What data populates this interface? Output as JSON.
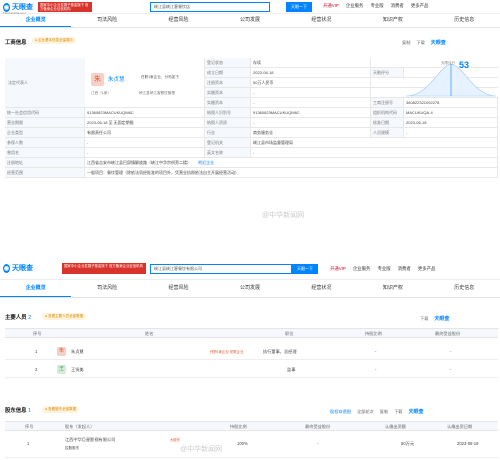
{
  "colors": {
    "brand": "#0084ff",
    "vip_red": "#d9342b",
    "label_bg": "#f5f8fc"
  },
  "header": {
    "logo_text": "天眼查",
    "logo_sub": "TianYanCha.com",
    "red_badge_1": "国家中小企业发展子基金旗下 官方备案企业征信机构",
    "red_badge_2": "国家中小企业发展子基金旗下 官方备案企业征信机构",
    "search_value_1": "峡江县峡江客餐饮店",
    "search_value_2": "峡江县峡江客餐饮有限公司",
    "search_button": "天眼一下",
    "links": [
      "企业服务",
      "应用中心",
      "专业版",
      "消费者",
      "更多产品",
      "消息",
      "APP"
    ],
    "vip_link": "开通VIP"
  },
  "tabs_1": [
    "企业概览",
    "司法风险",
    "经营风险",
    "公司发展",
    "经营状况",
    "知识产权",
    "历史信息"
  ],
  "tabs_2": [
    "企业概览",
    "司法风险",
    "经营风险",
    "公司发展",
    "经营状况",
    "知识产权",
    "历史信息"
  ],
  "business_info": {
    "title": "工商信息",
    "chip": "● 企业基本信息全量展示",
    "toolbar": [
      "复制",
      "下载",
      "天眼查"
    ],
    "legal_rep_label": "法定代表人",
    "legal_rep_avatar": "朱",
    "legal_rep_name": "朱贞慧",
    "legal_rep_role": "任职1家企业，分布如下",
    "legal_rep_loc": "江西（1家）",
    "legal_rep_desc": "峡江县峡江客餐饮管理",
    "rows": [
      {
        "l1": "登记状态",
        "v1": "存续",
        "l2": "",
        "v2": ""
      },
      {
        "l1": "成立日期",
        "v1": "2023-06-18",
        "l2": "天眼评分",
        "v2": ""
      },
      {
        "l1": "注册资本",
        "v1": "50万人民币",
        "l2": "",
        "v2": ""
      },
      {
        "l1": "实缴资本",
        "v1": "-",
        "l2": "工商注册号",
        "v2": "360822321092278"
      },
      {
        "lA": "统一社会信用代码",
        "vA": "91360823MACUKUQM6C",
        "l1": "纳税人识别号",
        "v1": "91360823MACUKUQM6C",
        "l2": "组织机构代码",
        "v2": "MACUKUQA-4"
      },
      {
        "lA": "营业期限",
        "vA": "2023-06-18 至 无固定期限",
        "l1": "纳税人资质",
        "v1": "-",
        "l2": "核准日期",
        "v2": "2023-06-18"
      },
      {
        "lA": "企业类型",
        "vA": "有限责任公司",
        "l1": "行业",
        "v1": "商务服务业",
        "l2": "人员规模",
        "v2": "-"
      },
      {
        "lA": "参保人数",
        "vA": "-",
        "l1": "登记机关",
        "v1": "峡江县市场监督管理局",
        "l2": "",
        "v2": ""
      },
      {
        "lA": "曾用名",
        "vA": "-",
        "l1": "英文名称",
        "v1": "-",
        "l2": "",
        "v2": ""
      }
    ],
    "score": "53",
    "address_label": "注册地址",
    "address": "江西省吉安市峡江县巴邱镇解放路（峡江中华宗祠旁二楼）",
    "address_link": "附近企业",
    "scope_label": "经营范围",
    "scope": "一般项目：餐饮管理（除依法须经批准的项目外，凭营业执照依法自主开展经营活动）"
  },
  "watermark": "@中华新闻网",
  "members": {
    "title": "主要人员",
    "count": "2",
    "chip": "● 查看主要人员全部数据",
    "toolbar": [
      "复制",
      "下载",
      "天眼查"
    ],
    "headers": [
      "序号",
      "姓名",
      "职位",
      "持股比例",
      "最终受益股份"
    ],
    "rows": [
      {
        "no": "1",
        "avatar": "朱",
        "name": "朱贞慧",
        "tag": "任职1家企业 关联企业",
        "position": "执行董事，总经理",
        "share": "-",
        "benefit": "-"
      },
      {
        "no": "2",
        "avatar": "王",
        "name": "王贤美",
        "tag": "",
        "position": "监事",
        "share": "-",
        "benefit": "-"
      }
    ]
  },
  "shareholders": {
    "title": "股东信息",
    "count": "1",
    "chip": "● 查看股东全部数据",
    "toolbar": [
      "股权穿透图",
      "全部轮次",
      "复制",
      "下载",
      "天眼查"
    ],
    "headers": [
      "序号",
      "股东（发起人）",
      "持股比例",
      "最终受益股份",
      "认缴出资额",
      "认缴出资日期"
    ],
    "rows": [
      {
        "no": "1",
        "name": "江西中华巨星影视有限公司",
        "tag": "大股东",
        "sub": "控股股东",
        "share": "100%",
        "benefit": "-",
        "amount": "50万元",
        "date": "2023-06-18"
      }
    ]
  }
}
